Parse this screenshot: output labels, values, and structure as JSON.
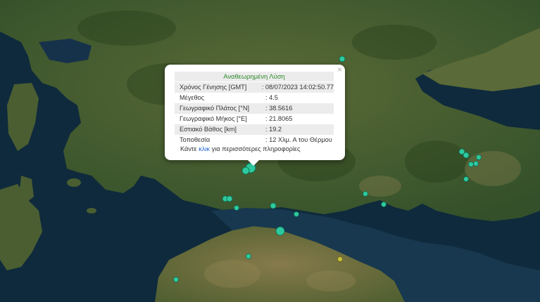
{
  "map": {
    "colors": {
      "sea": "#0f2a3c",
      "land_dark": "#2c4620",
      "land": "#4d6231",
      "land_light": "#7c7446",
      "marker": "#2ec99e",
      "marker_alt": "#c9c23a"
    },
    "selected_event": {
      "magnitude": 4.5
    }
  },
  "popup": {
    "title": "Αναθεωρημένη Λύση",
    "close_icon": "×",
    "rows": [
      {
        "label": "Χρόνος Γένησης [GMT]",
        "sep": ":",
        "value": "08/07/2023 14:02:50.77"
      },
      {
        "label": "Μέγεθος",
        "sep": ":",
        "value": "4.5"
      },
      {
        "label": "Γεωγραφικό Πλάτος [°N]",
        "sep": ":",
        "value": "38.5616"
      },
      {
        "label": "Γεωγραφικό Μήκος [°E]",
        "sep": ":",
        "value": "21.8065"
      },
      {
        "label": "Εστιακό Βάθος [km]",
        "sep": ":",
        "value": "19.2"
      },
      {
        "label": "Τοποθεσία",
        "sep": ":",
        "value": "12 Χλμ. Α του Θέρμου"
      }
    ],
    "footer_prefix": "Κάντε",
    "footer_link": "κλικ",
    "footer_suffix": "για περισσότερες πληροφορίες"
  }
}
